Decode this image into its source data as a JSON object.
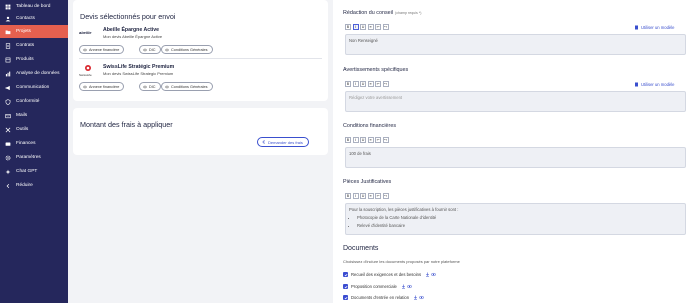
{
  "sidebar": {
    "items": [
      {
        "label": "Tableau de bord",
        "icon": "dashboard-icon",
        "active": false
      },
      {
        "label": "Contacts",
        "icon": "contacts-icon",
        "active": false
      },
      {
        "label": "Projets",
        "icon": "folder-icon",
        "active": true
      },
      {
        "label": "Contrats",
        "icon": "contract-icon",
        "active": false
      },
      {
        "label": "Produits",
        "icon": "products-icon",
        "active": false
      },
      {
        "label": "Analyse de données",
        "icon": "analytics-icon",
        "active": false
      },
      {
        "label": "Communication",
        "icon": "megaphone-icon",
        "active": false
      },
      {
        "label": "Conformité",
        "icon": "shield-icon",
        "active": false
      },
      {
        "label": "Mails",
        "icon": "mail-icon",
        "active": false
      },
      {
        "label": "Outils",
        "icon": "tools-icon",
        "active": false
      },
      {
        "label": "Finances",
        "icon": "finance-icon",
        "active": false
      },
      {
        "label": "Paramètres",
        "icon": "gear-icon",
        "active": false
      },
      {
        "label": "Chat GPT",
        "icon": "chat-icon",
        "active": false
      },
      {
        "label": "Réduire",
        "icon": "chevron-left-icon",
        "active": false
      }
    ]
  },
  "selected_quotes": {
    "title": "Devis sélectionnés pour envoi",
    "products": [
      {
        "logo_text": "abeille",
        "name": "Abeille Épargne Active",
        "subtitle": "Mon devis Abeille Épargne Active",
        "chips": [
          "Annexe financière",
          "DIC",
          "Conditions Générales"
        ]
      },
      {
        "logo_text": "SwissLife",
        "name": "SwissLife Stratégic Premium",
        "subtitle": "Mon devis SwissLife Strategic Premium",
        "chips": [
          "Annexe financière",
          "DIC",
          "Conditions Générales"
        ]
      }
    ]
  },
  "fees": {
    "title": "Montant des frais à appliquer",
    "button_label": "Demander des frais"
  },
  "advice": {
    "title": "Rédaction du conseil",
    "hint": "(champ requis *)",
    "model_link": "Utiliser un modèle",
    "value": "Non Renseigné"
  },
  "warnings": {
    "title": "Avertissements spécifiques",
    "model_link": "Utiliser un modèle",
    "placeholder": "Rédigez votre avertissement"
  },
  "financial": {
    "title": "Conditions financières",
    "value": "100 de frais"
  },
  "documents_required": {
    "title": "Pièces Justificatives",
    "intro": "Pour la souscription, les pièces justificatives à fournir sont :",
    "items": [
      "Photocopie de la Carte Nationale d'identité",
      "Relevé d'identité bancaire"
    ]
  },
  "toolbar": {
    "buttons": [
      "B",
      "I",
      "U",
      "≡",
      "↩",
      "↪"
    ]
  },
  "documents": {
    "title": "Documents",
    "subtitle": "Choisissez d'inclure les documents proposés par notre plateforme",
    "rows": [
      {
        "label": "Recueil des exigences et des besoins",
        "checked": true
      },
      {
        "label": "Proposition commerciale",
        "checked": true
      },
      {
        "label": "Documents d'entrée en relation",
        "checked": true
      }
    ]
  },
  "colors": {
    "sidebar_bg": "#25275c",
    "active_item": "#e5604f",
    "accent": "#3a4fce"
  }
}
